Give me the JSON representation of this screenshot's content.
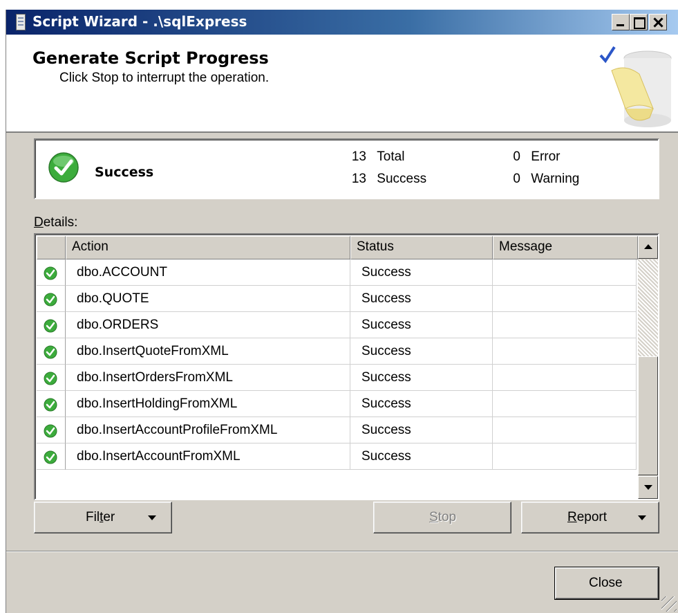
{
  "window": {
    "title": "Script Wizard - .\\sqlExpress"
  },
  "header": {
    "title": "Generate Script Progress",
    "subtitle": "Click Stop to interrupt the operation."
  },
  "summary": {
    "status": "Success",
    "total_count": "13",
    "total_label": "Total",
    "success_count": "13",
    "success_label": "Success",
    "error_count": "0",
    "error_label": "Error",
    "warning_count": "0",
    "warning_label": "Warning"
  },
  "details": {
    "label_prefix": "D",
    "label_rest": "etails:",
    "columns": {
      "action": "Action",
      "status": "Status",
      "message": "Message"
    },
    "rows": [
      {
        "action": "dbo.ACCOUNT",
        "status": "Success",
        "message": ""
      },
      {
        "action": "dbo.QUOTE",
        "status": "Success",
        "message": ""
      },
      {
        "action": "dbo.ORDERS",
        "status": "Success",
        "message": ""
      },
      {
        "action": "dbo.InsertQuoteFromXML",
        "status": "Success",
        "message": ""
      },
      {
        "action": "dbo.InsertOrdersFromXML",
        "status": "Success",
        "message": ""
      },
      {
        "action": "dbo.InsertHoldingFromXML",
        "status": "Success",
        "message": ""
      },
      {
        "action": "dbo.InsertAccountProfileFromXML",
        "status": "Success",
        "message": ""
      },
      {
        "action": "dbo.InsertAccountFromXML",
        "status": "Success",
        "message": ""
      }
    ]
  },
  "buttons": {
    "filter_pre": "Fil",
    "filter_key": "t",
    "filter_post": "er",
    "stop_key": "S",
    "stop_post": "top",
    "report_key": "R",
    "report_post": "eport",
    "close": "Close"
  },
  "colors": {
    "success_green": "#3cac3c",
    "titlebar": "#0a246a",
    "dialog_bg": "#d4d0c8"
  }
}
